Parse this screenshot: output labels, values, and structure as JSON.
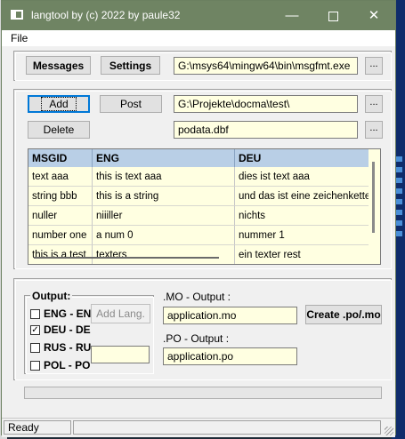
{
  "window": {
    "title": "langtool by (c) 2022 by paule32"
  },
  "titlebar": {
    "minimize_glyph": "—",
    "close_glyph": "✕"
  },
  "menu": {
    "file": "File"
  },
  "top": {
    "messages_label": "Messages",
    "settings_label": "Settings",
    "msgfmt_path": "G:\\msys64\\mingw64\\bin\\msgfmt.exe",
    "browse_label": "..."
  },
  "project": {
    "add_label": "Add",
    "post_label": "Post",
    "delete_label": "Delete",
    "project_path": "G:\\Projekte\\docma\\test\\",
    "db_file": "podata.dbf",
    "browse_label": "..."
  },
  "table": {
    "columns": [
      "MSGID",
      "ENG",
      "DEU"
    ],
    "rows": [
      [
        "text aaa",
        "this is text aaa",
        "dies ist text aaa"
      ],
      [
        "string bbb",
        "this is a string",
        "und das ist eine zeichenkette"
      ],
      [
        "nuller",
        "niiiller",
        "nichts"
      ],
      [
        "number one",
        "a num 0",
        "nummer 1"
      ],
      [
        "this is a test",
        "texters",
        "ein texter rest"
      ]
    ]
  },
  "output": {
    "group_label": "Output:",
    "languages": [
      {
        "label": "ENG - EN",
        "checked": false
      },
      {
        "label": "DEU - DE",
        "checked": true
      },
      {
        "label": "RUS - RU",
        "checked": false
      },
      {
        "label": "POL - PO",
        "checked": false
      }
    ],
    "add_lang_label": "Add Lang.",
    "new_lang_value": "",
    "mo_label": ".MO - Output :",
    "mo_value": "application.mo",
    "po_label": ".PO - Output :",
    "po_value": "application.po",
    "create_label": "Create .po/.mo"
  },
  "status": {
    "text": "Ready"
  },
  "colors": {
    "titlebar": "#6f8463",
    "field_bg": "#ffffe1",
    "header_bg": "#b9cfe6"
  }
}
